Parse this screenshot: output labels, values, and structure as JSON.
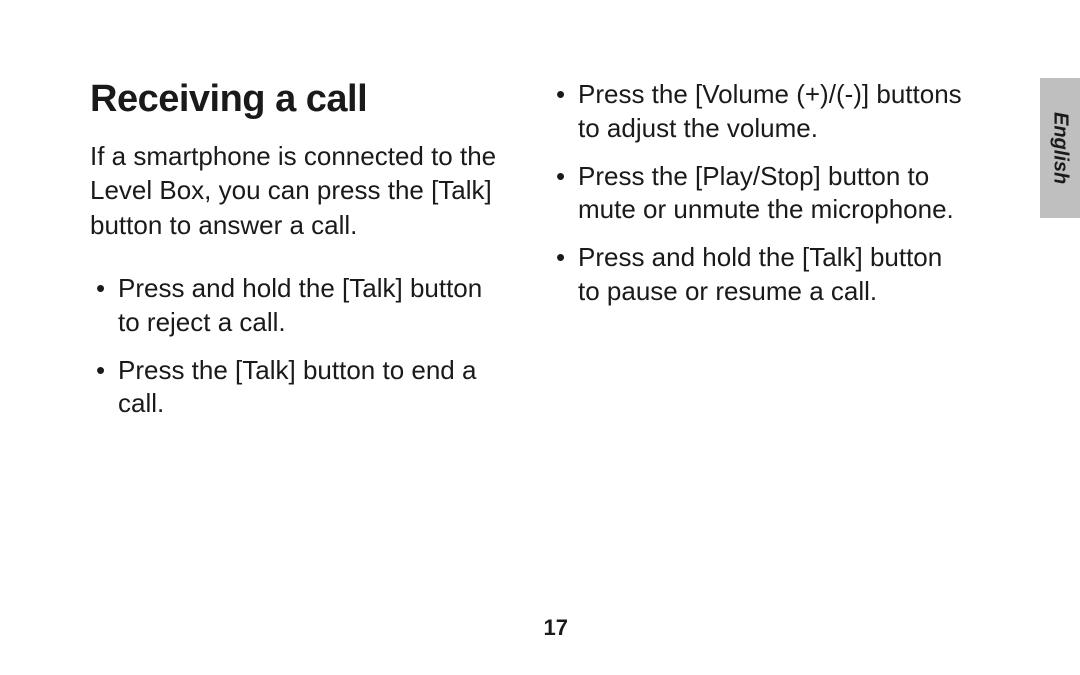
{
  "heading": "Receiving a call",
  "intro": "If a smartphone is connected to the Level Box, you can press the [Talk] button to answer a call.",
  "left_bullets": [
    "Press and hold the [Talk] button to reject a call.",
    "Press the [Talk] button to end a call."
  ],
  "right_bullets": [
    "Press the [Volume (+)/(-)] buttons to adjust the volume.",
    "Press the [Play/Stop] button to mute or unmute the microphone.",
    "Press and hold the [Talk] button to pause or resume a call."
  ],
  "language_tab": "English",
  "page_number": "17"
}
